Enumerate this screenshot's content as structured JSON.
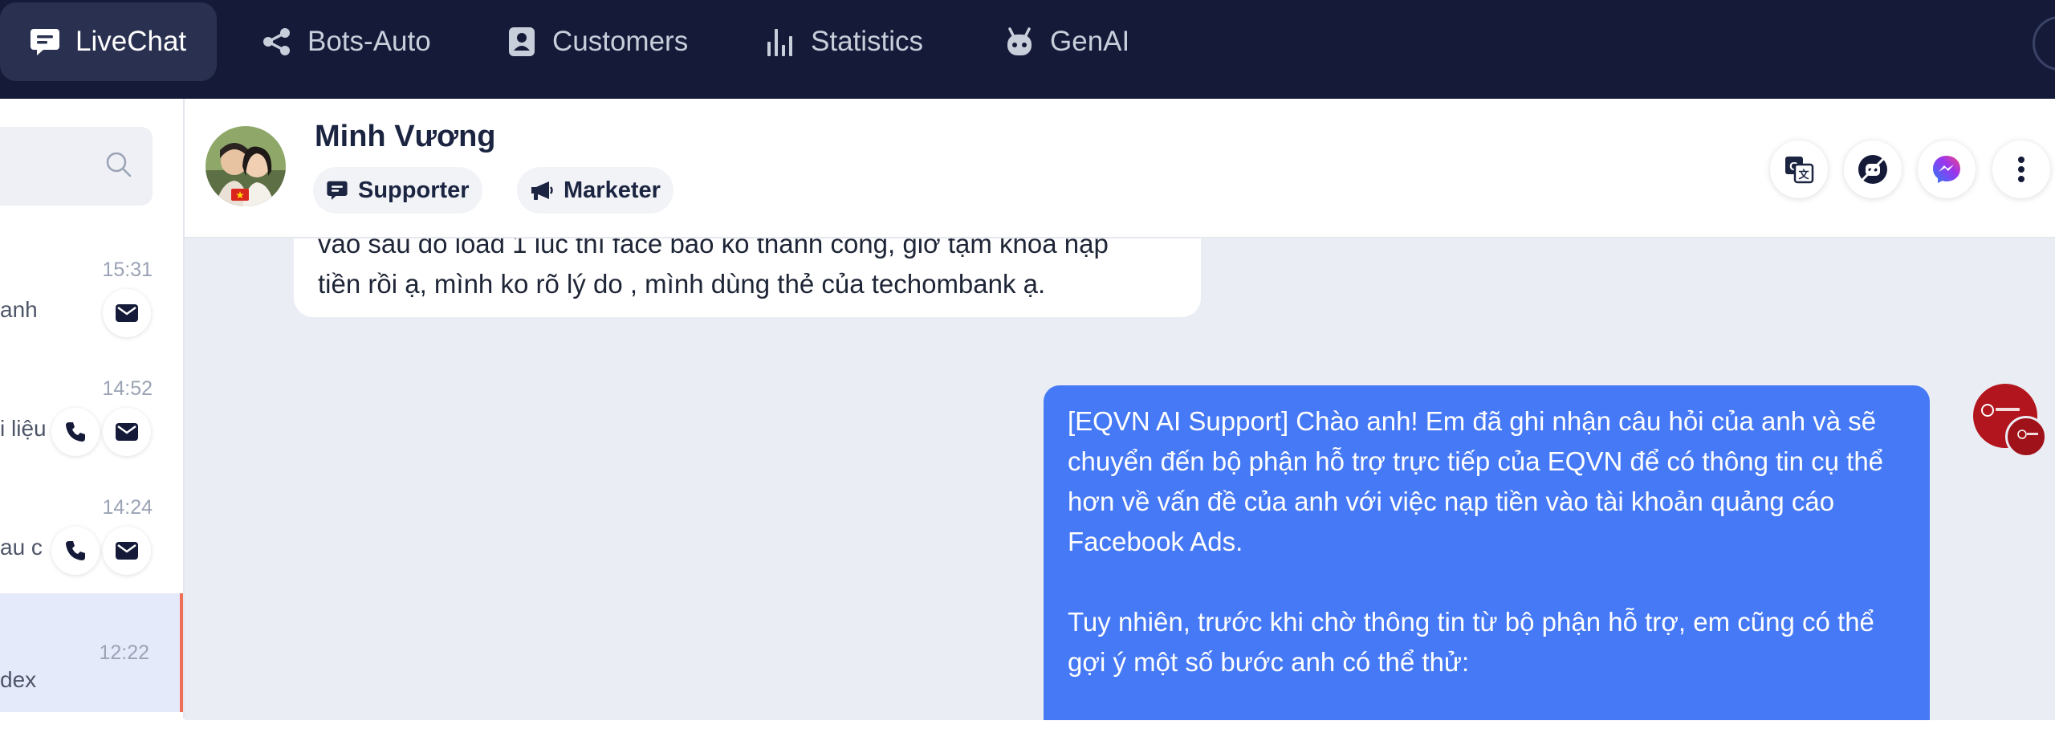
{
  "nav": {
    "items": [
      {
        "label": "LiveChat",
        "icon": "chat-bubble-icon",
        "active": true
      },
      {
        "label": "Bots-Auto",
        "icon": "share-nodes-icon"
      },
      {
        "label": "Customers",
        "icon": "contact-card-icon"
      },
      {
        "label": "Statistics",
        "icon": "bar-chart-icon"
      },
      {
        "label": "GenAI",
        "icon": "robot-icon"
      }
    ]
  },
  "conversations": [
    {
      "time": "15:31",
      "preview": "anh",
      "actions": [
        "mail-icon"
      ]
    },
    {
      "time": "14:52",
      "preview": "i liệu",
      "actions": [
        "phone-icon",
        "mail-icon"
      ]
    },
    {
      "time": "14:24",
      "preview": "au c",
      "actions": [
        "phone-icon",
        "mail-icon"
      ]
    },
    {
      "time": "12:22",
      "preview": "dex",
      "active": true
    }
  ],
  "contact": {
    "name": "Minh Vương",
    "tags": [
      {
        "label": "Supporter",
        "icon": "chat-bubble-icon"
      },
      {
        "label": "Marketer",
        "icon": "megaphone-icon"
      }
    ]
  },
  "header_actions": [
    "translate-icon",
    "ai-off-icon",
    "messenger-icon",
    "more-vertical-icon"
  ],
  "messages": {
    "incoming": {
      "line1": "vào sau đó load 1 lúc thì face báo ko thành công, giờ tạm khoá nạp",
      "line2": "tiền rồi ạ, mình ko rõ lý do , mình dùng thẻ của techombank ạ."
    },
    "outgoing": {
      "para1": " [EQVN AI Support] Chào anh! Em đã ghi nhận câu hỏi của anh và sẽ chuyển đến bộ phận hỗ trợ trực tiếp của EQVN để có thông tin cụ thể hơn về vấn đề của anh với việc nạp tiền vào tài khoản quảng cáo Facebook Ads.",
      "para2": "Tuy nhiên, trước khi chờ thông tin từ bộ phận hỗ trợ, em cũng có thể gợi ý một số bước anh có thể thử:"
    }
  },
  "colors": {
    "nav_bg": "#141a38",
    "outgoing_bubble": "#4679f5",
    "active_conversation_border": "#ef7056",
    "messenger": "#7b3cf0"
  }
}
